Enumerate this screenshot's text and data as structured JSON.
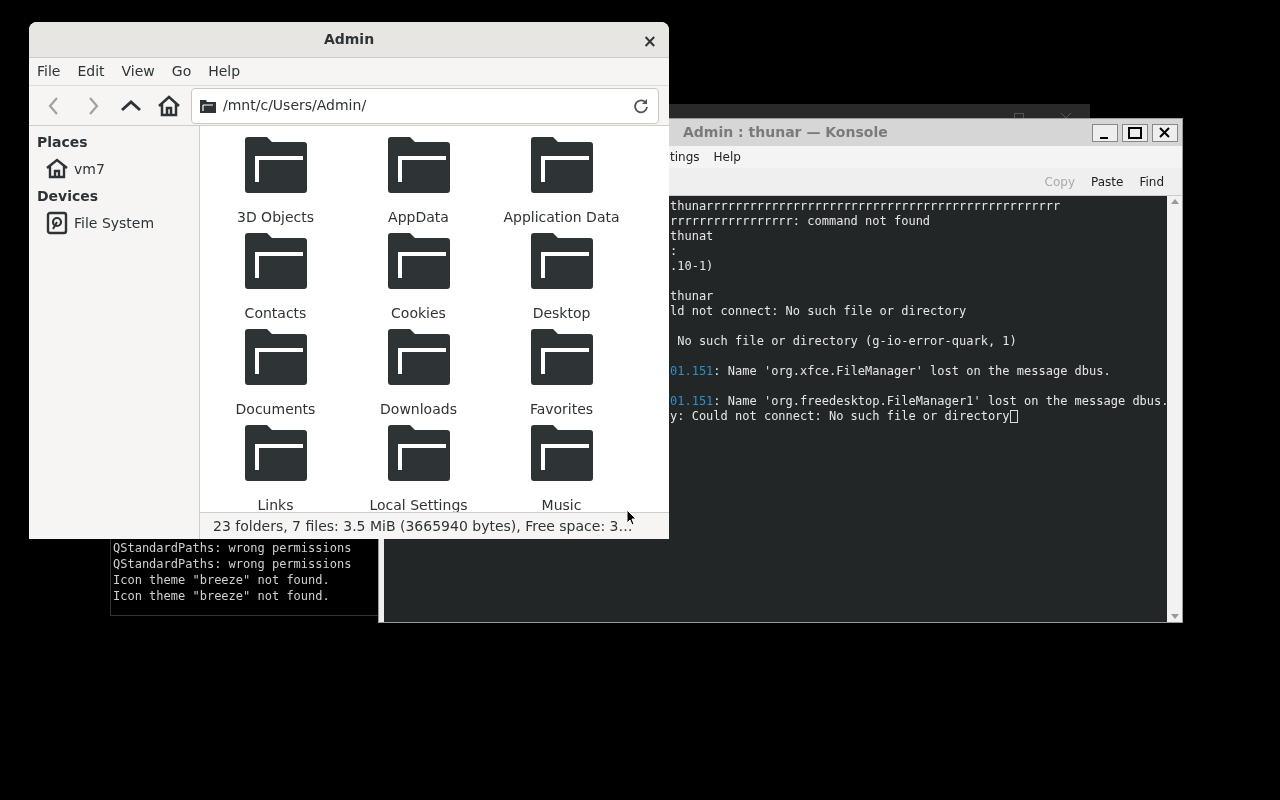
{
  "back_terminal": {
    "lines": [
      "QStandardPaths: wrong permissions",
      "QStandardPaths: wrong permissions",
      "Icon theme \"breeze\" not found.",
      "Icon theme \"breeze\" not found."
    ]
  },
  "konsole": {
    "title": "Admin : thunar — Konsole",
    "menu": [
      "tings",
      "Help"
    ],
    "toolbar": [
      {
        "label": "Copy",
        "disabled": true
      },
      {
        "label": "Paste",
        "disabled": false
      },
      {
        "label": "Find",
        "disabled": false
      }
    ],
    "lines": [
      {
        "text": "thunarrrrrrrrrrrrrrrrrrrrrrrrrrrrrrrrrrrrrrrrrrrrrrrrr"
      },
      {
        "text": "rrrrrrrrrrrrrrrrr: command not found"
      },
      {
        "text": "thunat"
      },
      {
        "text": ":"
      },
      {
        "text": ".10-1)"
      },
      {
        "blank": true
      },
      {
        "text": "thunar"
      },
      {
        "text": "ld not connect: No such file or directory"
      },
      {
        "blank": true
      },
      {
        "text": " No such file or directory (g-io-error-quark, 1)"
      },
      {
        "blank": true
      },
      {
        "prefix": "01.151",
        "text": ": Name 'org.xfce.FileManager' lost on the message dbus."
      },
      {
        "blank": true
      },
      {
        "prefix": "01.151",
        "text": ": Name 'org.freedesktop.FileManager1' lost on the message dbus."
      },
      {
        "text": "y: Could not connect: No such file or directory",
        "cursor": true
      }
    ]
  },
  "thunar": {
    "title": "Admin",
    "close": "×",
    "menu": [
      "File",
      "Edit",
      "View",
      "Go",
      "Help"
    ],
    "nav": [
      {
        "kind": "back",
        "disabled": true
      },
      {
        "kind": "forward",
        "disabled": true
      },
      {
        "kind": "up",
        "disabled": false
      },
      {
        "kind": "home",
        "disabled": false
      }
    ],
    "path": "/mnt/c/Users/Admin/",
    "sidebar": [
      {
        "heading": "Places",
        "items": [
          {
            "kind": "home",
            "label": "vm7"
          }
        ]
      },
      {
        "heading": "Devices",
        "items": [
          {
            "kind": "drive",
            "label": "File System"
          }
        ]
      }
    ],
    "folders": [
      "3D Objects",
      "AppData",
      "Application Data",
      "Contacts",
      "Cookies",
      "Desktop",
      "Documents",
      "Downloads",
      "Favorites",
      "Links",
      "Local Settings",
      "Music"
    ],
    "status": "23 folders, 7 files: 3.5 MiB (3665940 bytes), Free space: 3…"
  }
}
